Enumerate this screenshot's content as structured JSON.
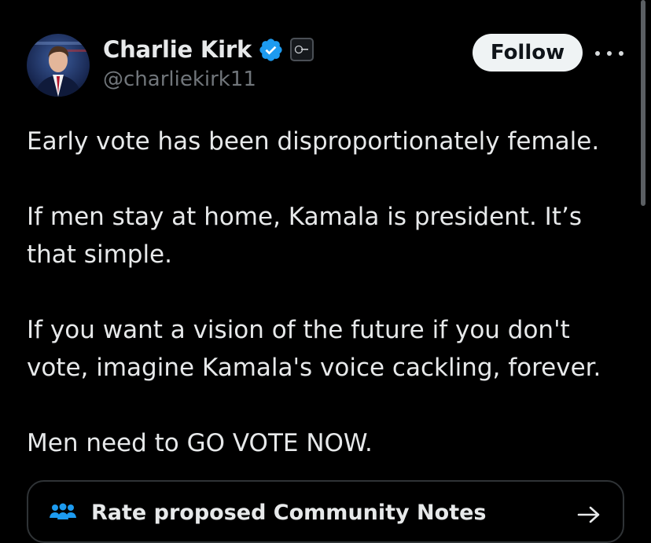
{
  "author": {
    "display_name": "Charlie Kirk",
    "handle": "@charliekirk11",
    "verified_icon": "verified-badge-icon",
    "affiliate_icon": "affiliate-badge-icon"
  },
  "actions": {
    "follow_label": "Follow",
    "more_icon": "more-options-icon"
  },
  "tweet": {
    "paragraphs": [
      "Early vote has been disproportionately female.",
      "If men stay at home, Kamala is president. It’s that simple.",
      "If you want a vision of the future if you don't vote, imagine Kamala's voice cackling, forever.",
      "Men need to GO VOTE NOW."
    ]
  },
  "community_notes": {
    "label": "Rate proposed Community Notes",
    "icon": "people-icon",
    "arrow_icon": "arrow-right-icon"
  },
  "colors": {
    "background": "#000000",
    "text_primary": "#e7e9ea",
    "text_secondary": "#71767b",
    "verified_blue": "#1d9bf0",
    "notes_icon_blue": "#1d9bf0",
    "follow_bg": "#eff3f4"
  }
}
